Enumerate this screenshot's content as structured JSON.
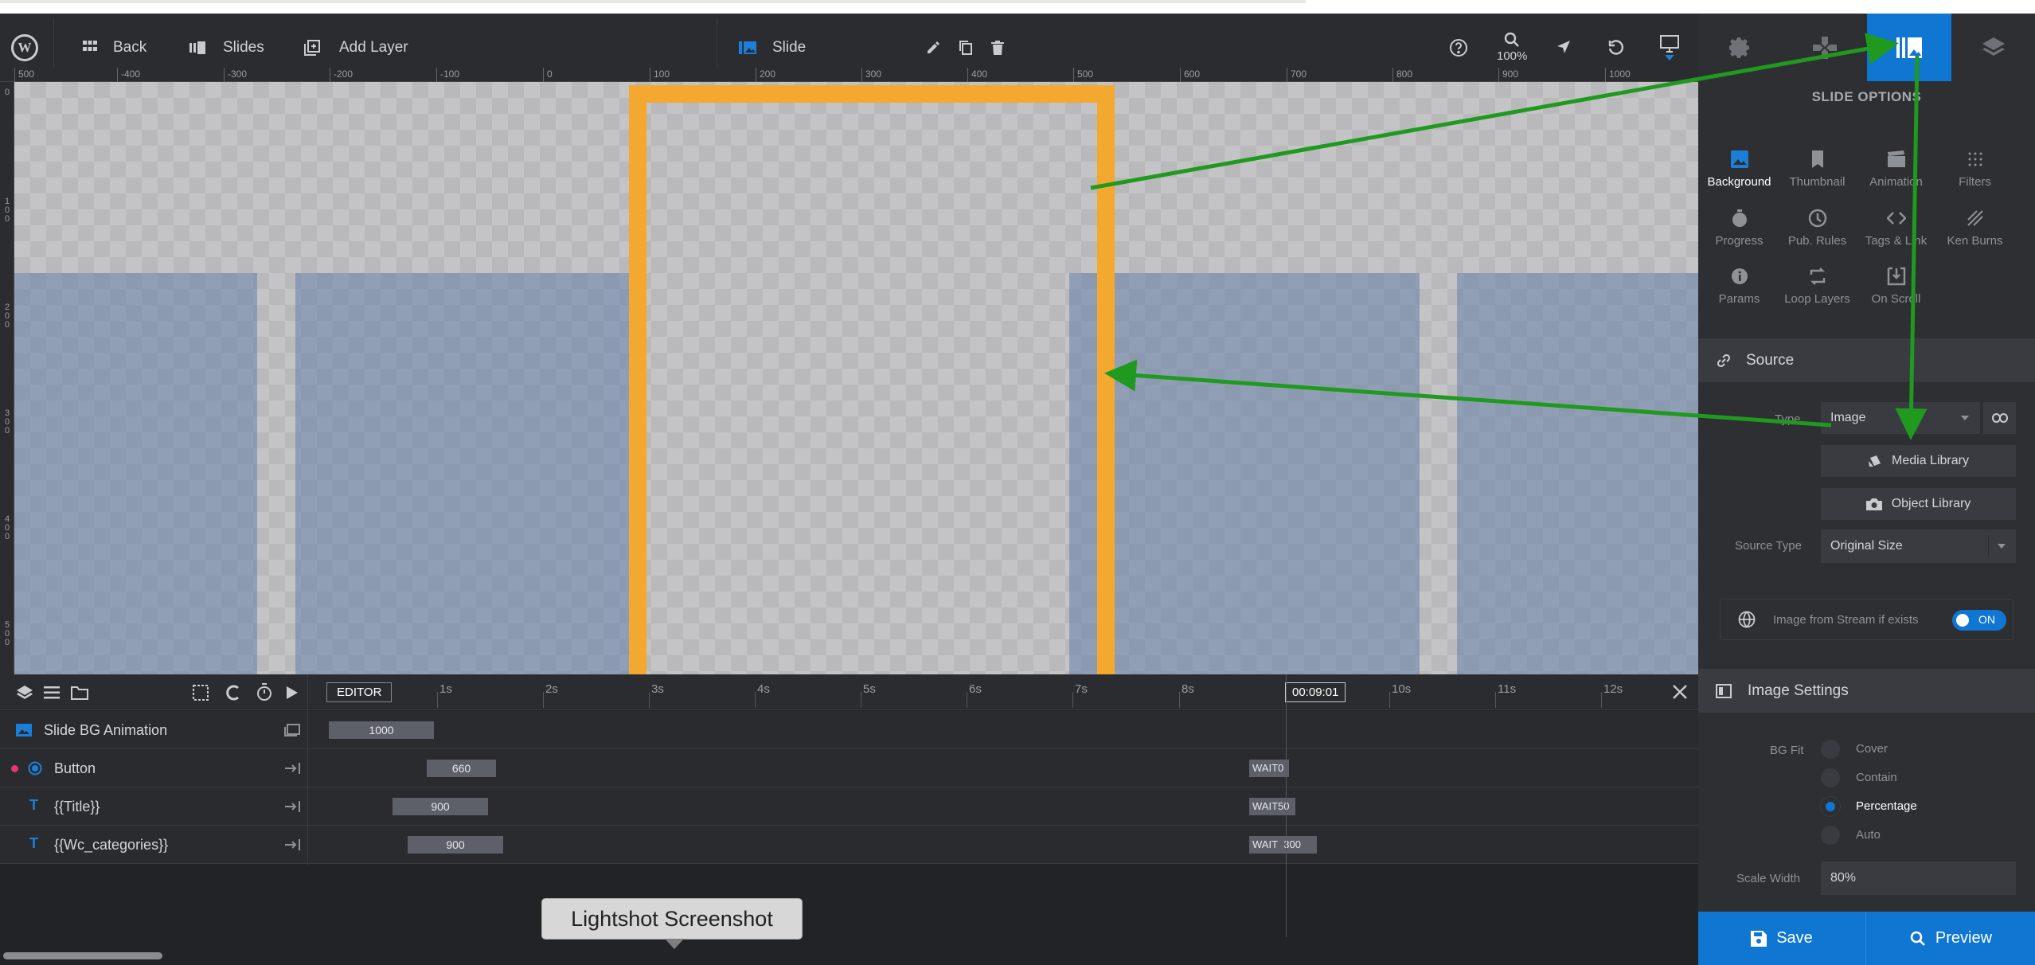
{
  "toolbar": {
    "back_label": "Back",
    "slides_label": "Slides",
    "add_layer_label": "Add Layer",
    "slide_label": "Slide",
    "zoom_label": "100%"
  },
  "ruler": {
    "h_ticks": [
      "500",
      "-400",
      "-300",
      "-200",
      "-100",
      "0",
      "100",
      "200",
      "300",
      "400",
      "500",
      "600",
      "700",
      "800",
      "900",
      "1000"
    ],
    "v_ticks": [
      "0",
      "100",
      "200",
      "300",
      "400",
      "500"
    ]
  },
  "right_panel": {
    "title": "SLIDE OPTIONS",
    "options": [
      {
        "label": "Background",
        "icon": "image-icon",
        "active": true
      },
      {
        "label": "Thumbnail",
        "icon": "bookmark-icon",
        "active": false
      },
      {
        "label": "Animation",
        "icon": "clapperboard-icon",
        "active": false
      },
      {
        "label": "Filters",
        "icon": "filters-icon",
        "active": false
      },
      {
        "label": "Progress",
        "icon": "stopwatch-icon",
        "active": false
      },
      {
        "label": "Pub. Rules",
        "icon": "clock-icon",
        "active": false
      },
      {
        "label": "Tags & Link",
        "icon": "code-icon",
        "active": false
      },
      {
        "label": "Ken Burns",
        "icon": "ken-burns-icon",
        "active": false
      },
      {
        "label": "Params",
        "icon": "info-icon",
        "active": false
      },
      {
        "label": "Loop Layers",
        "icon": "loop-icon",
        "active": false
      },
      {
        "label": "On Scroll",
        "icon": "on-scroll-icon",
        "active": false
      }
    ],
    "source_section": "Source",
    "type_label": "Type",
    "type_value": "Image",
    "media_library": "Media Library",
    "object_library": "Object Library",
    "source_type_label": "Source Type",
    "source_type_value": "Original Size",
    "stream_label": "Image from Stream if exists",
    "stream_toggle": "ON",
    "image_settings_section": "Image Settings",
    "bg_fit_label": "BG Fit",
    "bg_fit_options": [
      "Cover",
      "Contain",
      "Percentage",
      "Auto"
    ],
    "bg_fit_selected": "Percentage",
    "scale_width_label": "Scale Width",
    "scale_width_value": "80%",
    "save_label": "Save",
    "preview_label": "Preview"
  },
  "timeline": {
    "editor_label": "EDITOR",
    "time_ticks": [
      "1s",
      "2s",
      "3s",
      "4s",
      "5s",
      "6s",
      "7s",
      "8s",
      "10s",
      "11s",
      "12s"
    ],
    "current_time": "00:09:01",
    "rows": [
      {
        "name": "Slide BG Animation",
        "bar": "1000",
        "wait": ""
      },
      {
        "name": "Button",
        "bar": "660",
        "wait": "WAIT",
        "wait_value": "0"
      },
      {
        "name": "{{Title}}",
        "bar": "900",
        "wait": "WAIT",
        "wait_value": "50"
      },
      {
        "name": "{{Wc_categories}}",
        "bar": "900",
        "wait": "WAIT",
        "wait_value": "300"
      }
    ]
  },
  "tooltip": "Lightshot Screenshot",
  "colors": {
    "accent": "#0f76d2",
    "highlight": "#f3a92f",
    "arrow": "#1f9a1f",
    "panel": "#2e2f33"
  }
}
